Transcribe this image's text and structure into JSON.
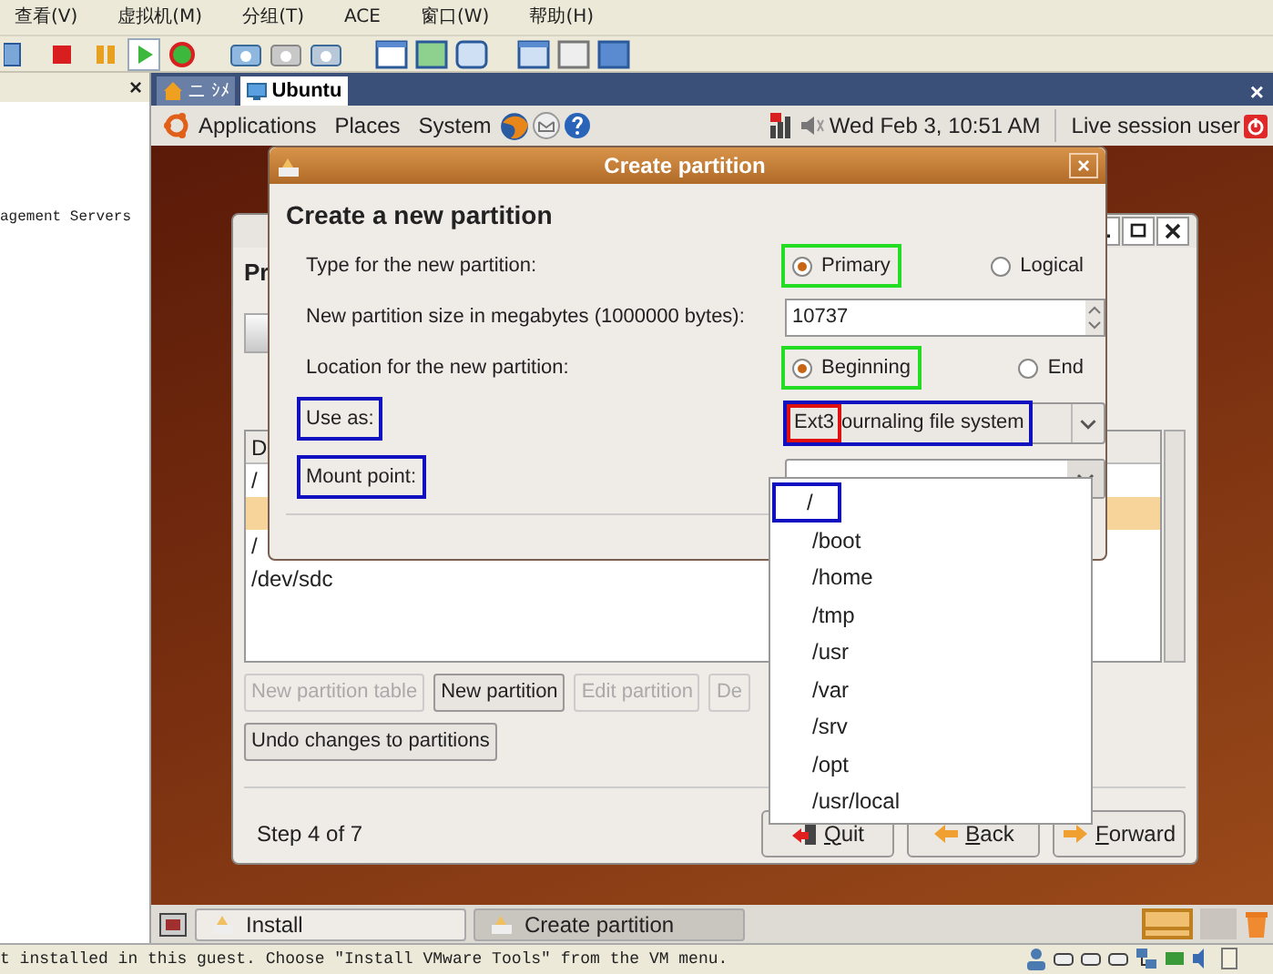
{
  "host_menu": [
    {
      "label": "查看(V)"
    },
    {
      "label": "虚拟机(M)"
    },
    {
      "label": "分组(T)"
    },
    {
      "label": "ACE"
    },
    {
      "label": "窗口(W)"
    },
    {
      "label": "帮助(H)"
    }
  ],
  "host_sidebar": {
    "close": "×",
    "text": "agement Servers"
  },
  "vm_tabs": [
    {
      "label": "ニ ｼﾒ",
      "selected": false
    },
    {
      "label": "Ubuntu",
      "selected": true
    }
  ],
  "vm_tabs_close": "×",
  "top_panel": {
    "menus": [
      "Applications",
      "Places",
      "System"
    ],
    "clock": "Wed Feb  3, 10:51 AM",
    "user": "Live session user"
  },
  "installer": {
    "title": "Pr",
    "table": {
      "header": "D",
      "rows": [
        {
          "cell": "/",
          "selected": false
        },
        {
          "selected": true
        },
        {
          "cell": "/",
          "selected": false
        },
        {
          "cell": "/dev/sdc",
          "selected": false
        }
      ]
    },
    "buttons": [
      {
        "label": "New partition table",
        "disabled": true
      },
      {
        "label": "New partition",
        "disabled": false
      },
      {
        "label": "Edit partition",
        "disabled": true
      },
      {
        "label": "De",
        "disabled": true
      }
    ],
    "undo": "Undo changes to partitions",
    "step": "Step 4 of 7",
    "nav": [
      {
        "kind": "quit",
        "label": "Quit"
      },
      {
        "kind": "back",
        "label": "Back"
      },
      {
        "kind": "forward",
        "label": "Forward"
      }
    ]
  },
  "dialog": {
    "title": "Create partition",
    "close": "×",
    "heading": "Create a new partition",
    "type": {
      "label": "Type for the new partition:",
      "options": [
        {
          "label": "Primary",
          "selected": true,
          "color": "#22dd22"
        },
        {
          "label": "Logical",
          "selected": false
        }
      ]
    },
    "size": {
      "label": "New partition size in megabytes (1000000 bytes):",
      "value": "10737"
    },
    "location": {
      "label": "Location for the new partition:",
      "options": [
        {
          "label": "Beginning",
          "selected": true,
          "color": "#22dd22"
        },
        {
          "label": "End",
          "selected": false
        }
      ]
    },
    "use_as": {
      "label": {
        "text": "Use as:",
        "color": "#1010c0"
      },
      "value": {
        "color": "#1010c0",
        "start": {
          "text": "Ext3",
          "color": "#e01010"
        },
        "rest": "ournaling file system"
      }
    },
    "mount_point": {
      "label": {
        "text": "Mount point:",
        "color": "#1010c0"
      },
      "options": [
        {
          "label": "/",
          "color": "#1010c0"
        },
        {
          "label": "/boot"
        },
        {
          "label": "/home"
        },
        {
          "label": "/tmp"
        },
        {
          "label": "/usr"
        },
        {
          "label": "/var"
        },
        {
          "label": "/srv"
        },
        {
          "label": "/opt"
        },
        {
          "label": "/usr/local"
        }
      ]
    }
  },
  "taskbar": [
    {
      "label": "Install",
      "selected": false
    },
    {
      "label": "Create partition",
      "selected": true
    }
  ],
  "status_bar": "t installed in this guest. Choose \"Install VMware Tools\" from the VM menu."
}
